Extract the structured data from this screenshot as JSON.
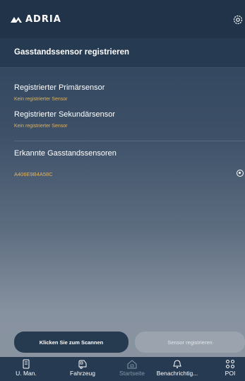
{
  "header": {
    "logo_text": "ADRIA",
    "settings_icon": "gear-icon"
  },
  "subheader": {
    "title": "Gasstandssensor registrieren"
  },
  "primary": {
    "label": "Registrierter Primärsensor",
    "status": "Kein registrierter Sensor"
  },
  "secondary": {
    "label": "Registrierter Sekundärsensor",
    "status": "Kein registrierter Sensor"
  },
  "detected": {
    "title": "Erkannte Gasstandssensoren",
    "items": [
      {
        "id": "A406E9B4A58C",
        "selected": true
      }
    ]
  },
  "buttons": {
    "scan": "Klicken Sie zum Scannen",
    "register": "Sensor registrieren"
  },
  "tabbar": {
    "tabs": [
      {
        "label": "U. Man.",
        "icon": "manual-icon",
        "active": false
      },
      {
        "label": "Fahrzeug",
        "icon": "vehicle-icon",
        "active": false
      },
      {
        "label": "Startseite",
        "icon": "home-icon",
        "active": true
      },
      {
        "label": "Benachrichtig...",
        "icon": "notification-icon",
        "active": false
      },
      {
        "label": "POI",
        "icon": "poi-icon",
        "active": false
      }
    ]
  },
  "colors": {
    "header_bg": "#203349",
    "accent_status": "#e0b25c",
    "button_dark": "#263a50",
    "button_disabled": "#9aa3ae"
  }
}
